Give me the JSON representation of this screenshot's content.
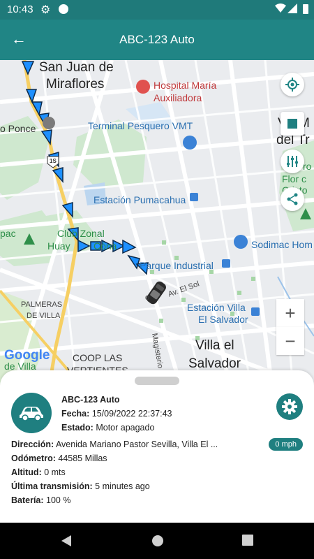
{
  "status_bar": {
    "time": "10:43"
  },
  "app_bar": {
    "title": "ABC-123 Auto",
    "back_icon": "arrow-back-icon"
  },
  "map": {
    "labels": {
      "san_juan_1": "San Juan de",
      "san_juan_2": "Miraflores",
      "hospital_1": "Hospital María",
      "hospital_2": "Auxiliadora",
      "ponce": "o Ponce",
      "terminal": "Terminal Pesquero VMT",
      "estacion_pumacahua": "Estación Pumacahua",
      "club_1": "Club Zonal",
      "club_2": "Huay",
      "club_3": "Cóna",
      "pac": "pac",
      "parque": "Parque Industrial",
      "sodimac": "Sodimac Hom",
      "av_el_sol": "Av. El Sol",
      "estacion_villa_1": "Estación Villa",
      "estacion_villa_2": "El Salvador",
      "palmeras_1": "PALMERAS",
      "palmeras_2": "DE VILLA",
      "villa_1": "Villa el",
      "villa_2": "Salvador",
      "coop_1": "COOP LAS",
      "coop_2": "VERTIENTES",
      "de_villa": "de Villa",
      "magisterio": "Magisterio",
      "right_1": "V",
      "right_2": "M",
      "right_3": "del Tr",
      "right_4": "ro",
      "right_5": "Flor c",
      "right_6": "Cristo",
      "google": "Google",
      "highway": "1S",
      "car_marker": "o"
    },
    "zoom_in": "+",
    "zoom_out": "−"
  },
  "vehicle": {
    "name": "ABC-123 Auto",
    "fecha_label": "Fecha:",
    "fecha": "15/09/2022 22:37:43",
    "estado_label": "Estado:",
    "estado": "Motor apagado",
    "direccion_label": "Dirección:",
    "direccion": "Avenida Mariano Pastor Sevilla, Villa El ...",
    "speed": "0 mph",
    "odometro_label": "Odómetro:",
    "odometro": "44585 Millas",
    "altitud_label": "Altitud:",
    "altitud": "0 mts",
    "transmision_label": "Última transmisión:",
    "transmision": "5 minutes ago",
    "bateria_label": "Batería:",
    "bateria": "100 %"
  },
  "colors": {
    "primary": "#208585",
    "status_bar": "#1f7a7a",
    "route": "#1e90ff"
  }
}
